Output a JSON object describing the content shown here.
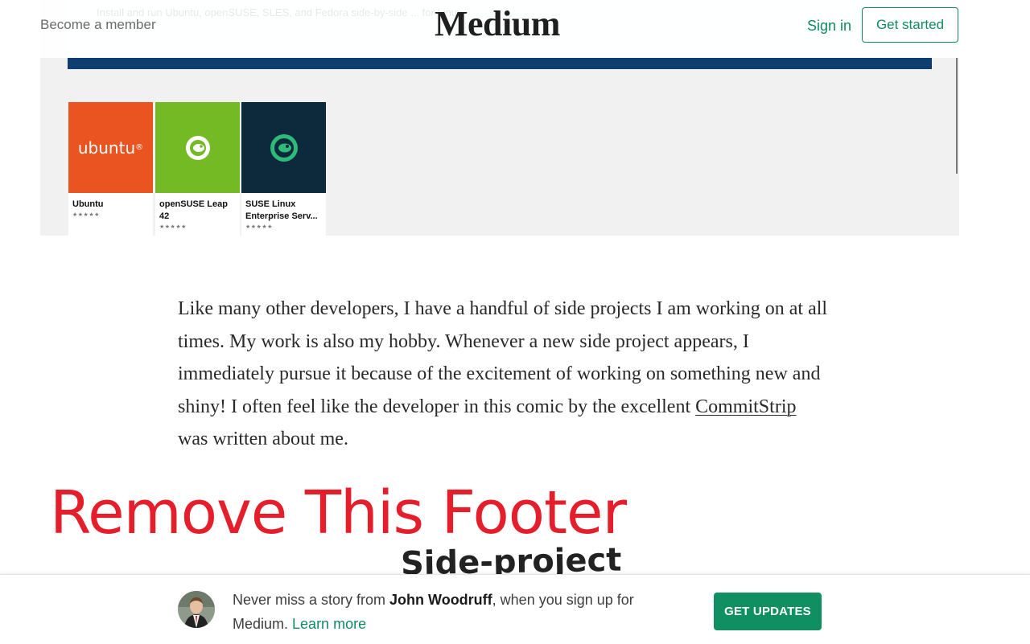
{
  "header": {
    "become_member": "Become a member",
    "logo": "Medium",
    "sign_in": "Sign in",
    "get_started": "Get started",
    "faded_caption": "Install and run Ubuntu, openSUSE, SLES, and Fedora side-by-side ... for Linux"
  },
  "screenshot": {
    "apps": [
      {
        "name_line1": "Ubuntu",
        "name_line2": "",
        "stars": "★★★★★",
        "logo_text": "ubuntu",
        "logo_mark": "®",
        "color": "#e95420"
      },
      {
        "name_line1": "openSUSE Leap",
        "name_line2": "42",
        "stars": "★★★★★",
        "color": "#73ba25"
      },
      {
        "name_line1": "SUSE Linux",
        "name_line2": "Enterprise Serv...",
        "stars": "★★★★★",
        "color": "#0c2a3b"
      }
    ]
  },
  "article": {
    "paragraph_before_link": "Like many other developers, I have a handful of side projects I am working on at all times. My work is also my hobby. Whenever a new side project appears, I immediately pursue it because of the excitement of working on something new and shiny! I often feel like the developer in this comic by the excellent ",
    "link_text": "CommitStrip",
    "paragraph_after_link": " was written about me."
  },
  "overlay": {
    "annotation": "Remove This Footer",
    "comic_title": "Side-project"
  },
  "footer": {
    "text_before": "Never miss a story from ",
    "author": "John Woodruff",
    "text_middle": ", when you sign up for Medium. ",
    "learn_more": "Learn more",
    "button": "GET UPDATES"
  },
  "colors": {
    "brand_green": "#0f8a5f",
    "annotation_red": "#e41e2b"
  }
}
